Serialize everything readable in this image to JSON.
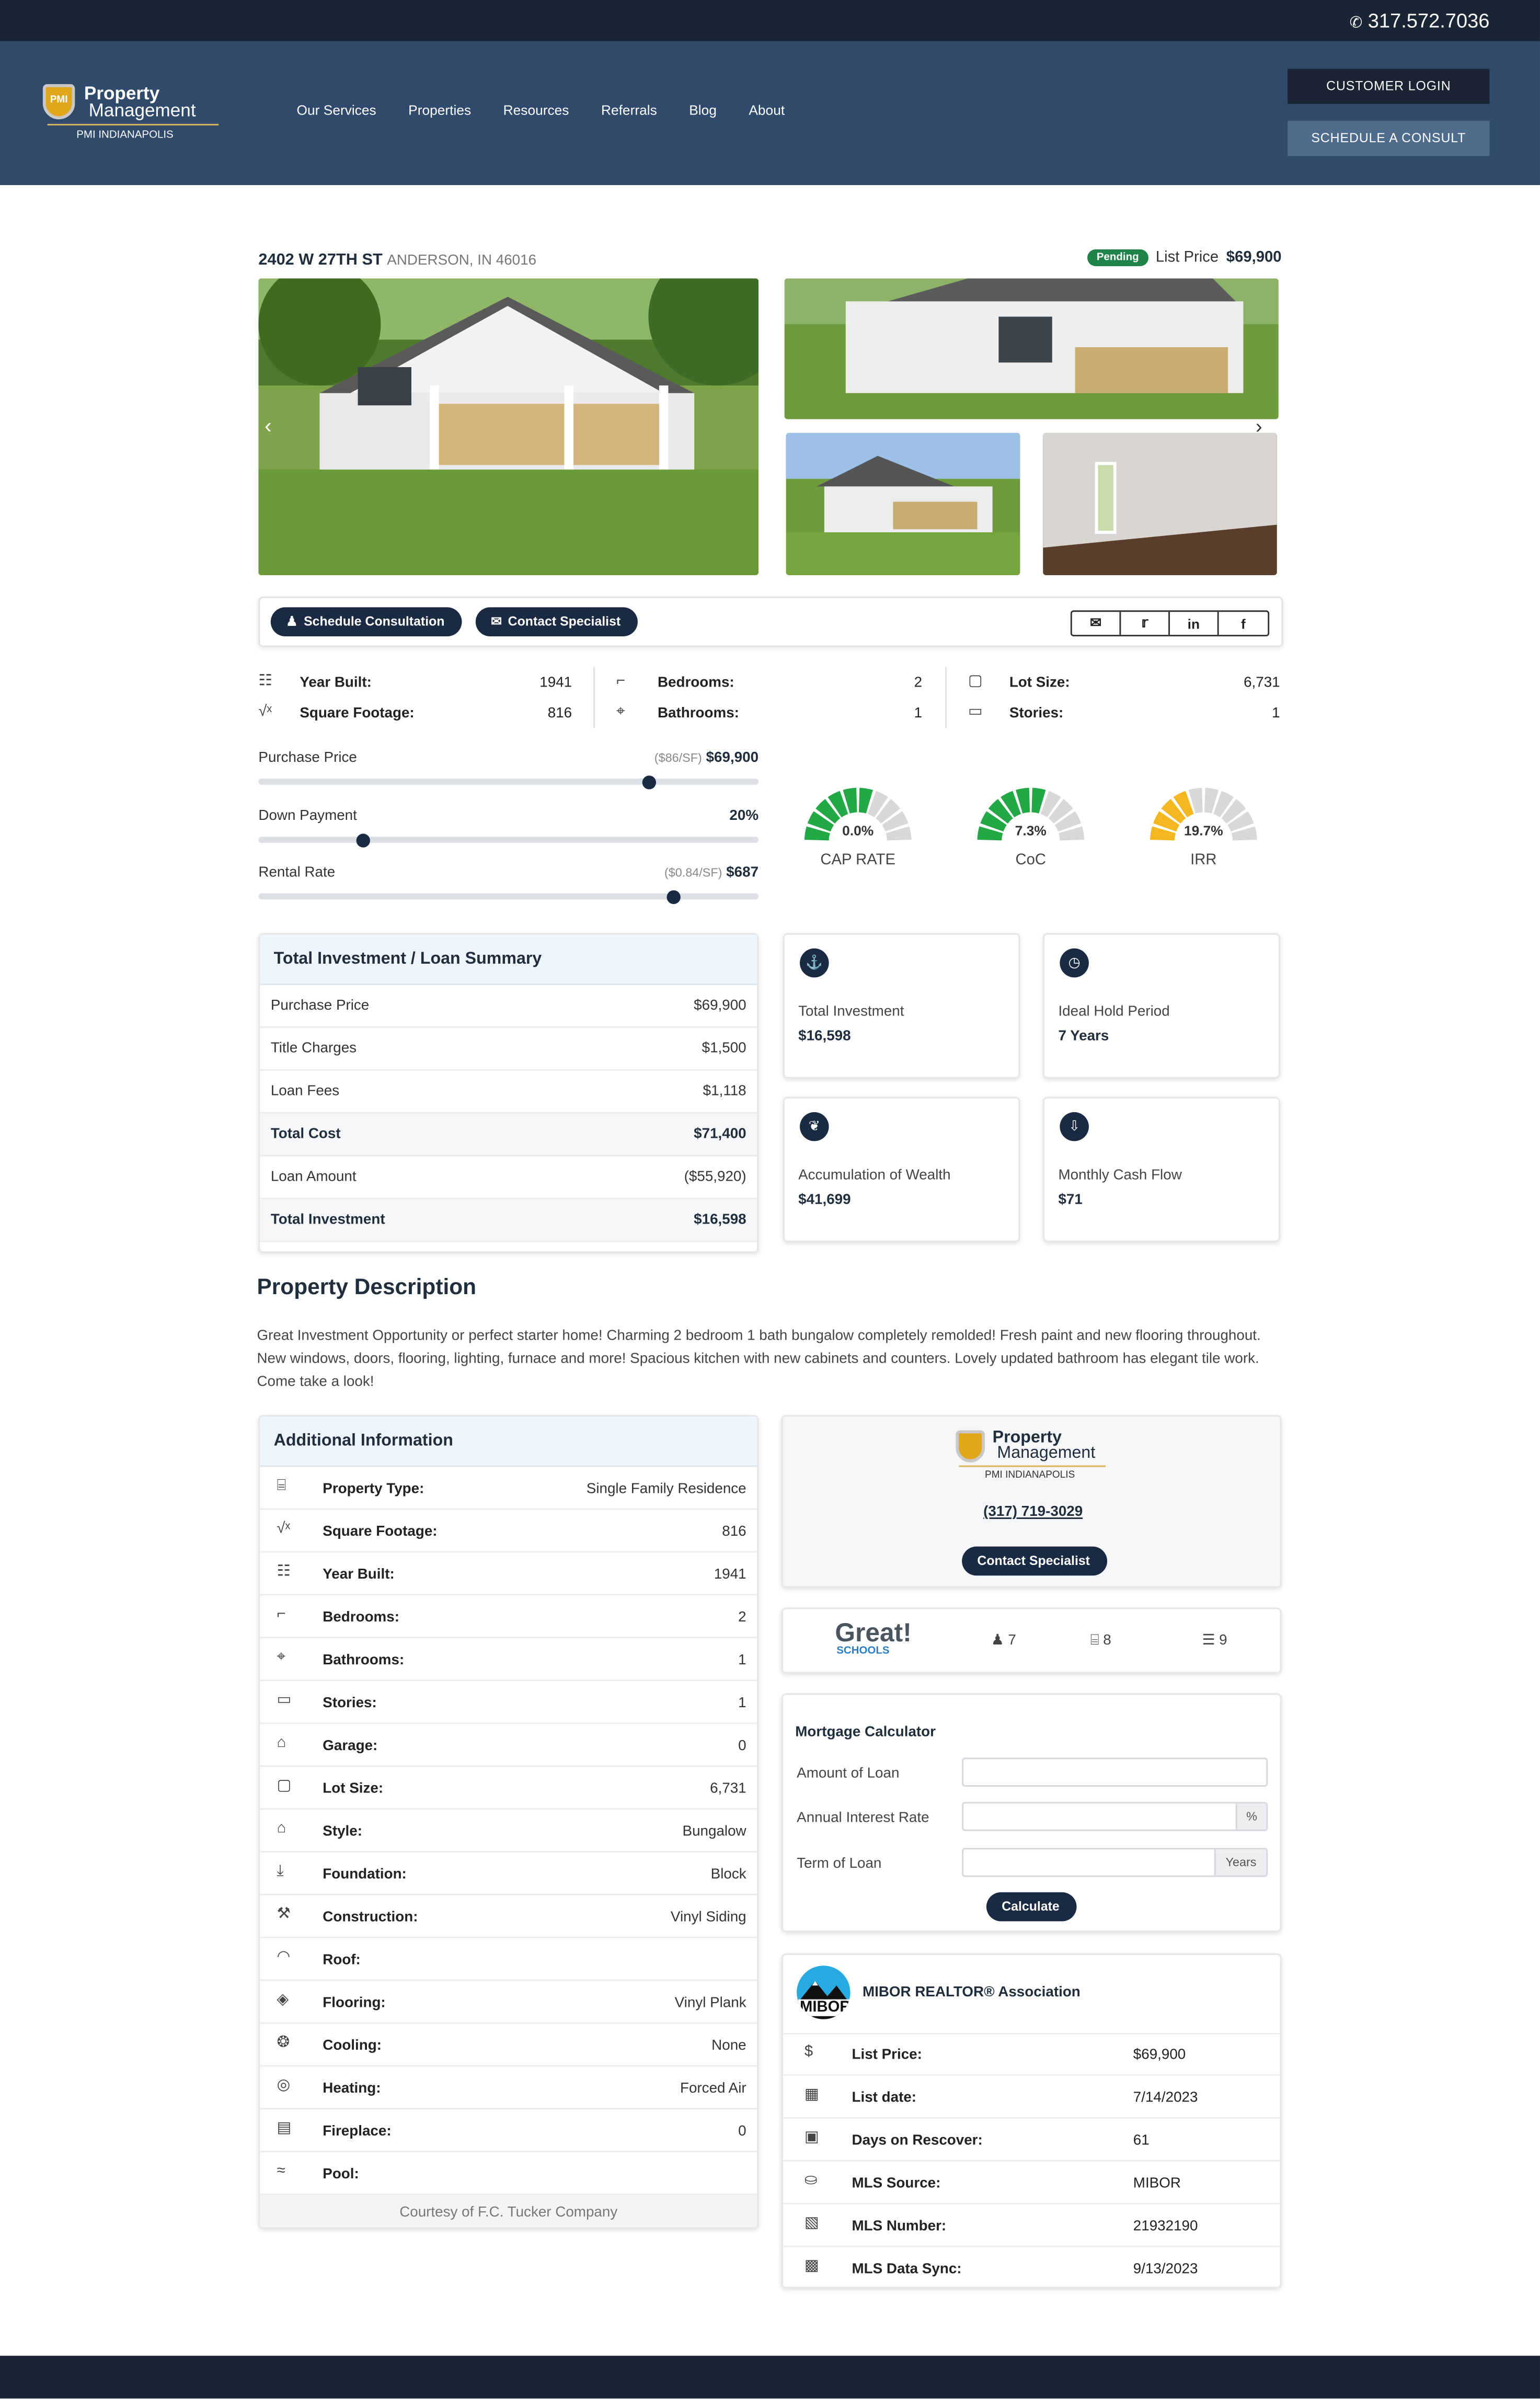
{
  "topbar": {
    "phone": "317.572.7036"
  },
  "header": {
    "logo": {
      "brand_line1": "Property",
      "brand_line2": "Management",
      "badge": "PMI",
      "sub": "PMI INDIANAPOLIS"
    },
    "nav": [
      "Our Services",
      "Properties",
      "Resources",
      "Referrals",
      "Blog",
      "About"
    ],
    "customer_login": "CUSTOMER LOGIN",
    "schedule_consult": "SCHEDULE A CONSULT"
  },
  "listing": {
    "street": "2402 W 27TH ST",
    "city": "ANDERSON, IN 46016",
    "status": "Pending",
    "list_price_label": "List Price",
    "list_price": "$69,900"
  },
  "actions": {
    "schedule": "Schedule Consultation",
    "contact": "Contact Specialist",
    "share_icons": [
      "mail-icon",
      "twitter-icon",
      "linkedin-icon",
      "facebook-icon"
    ]
  },
  "facts": [
    {
      "icon": "cake-icon",
      "label": "Year Built:",
      "value": "1941"
    },
    {
      "icon": "sqrt-icon",
      "label": "Square Footage:",
      "value": "816"
    },
    {
      "icon": "bed-icon",
      "label": "Bedrooms:",
      "value": "2"
    },
    {
      "icon": "bath-icon",
      "label": "Bathrooms:",
      "value": "1"
    },
    {
      "icon": "square-icon",
      "label": "Lot Size:",
      "value": "6,731"
    },
    {
      "icon": "stories-icon",
      "label": "Stories:",
      "value": "1"
    }
  ],
  "sliders": [
    {
      "label": "Purchase Price",
      "note": "($86/SF)",
      "value": "$69,900",
      "position": 0.78
    },
    {
      "label": "Down Payment",
      "note": "",
      "value": "20%",
      "position": 0.21
    },
    {
      "label": "Rental Rate",
      "note": "($0.84/SF)",
      "value": "$687",
      "position": 0.83
    }
  ],
  "gauges": [
    {
      "label": "CAP RATE",
      "value": "0.0%",
      "segments_filled": 6,
      "color": "#22a845"
    },
    {
      "label": "CoC",
      "value": "7.3%",
      "segments_filled": 6,
      "color": "#22a845"
    },
    {
      "label": "IRR",
      "value": "19.7%",
      "segments_filled": 4,
      "color": "#f4b71f"
    }
  ],
  "summary": {
    "title": "Total Investment / Loan Summary",
    "rows": [
      {
        "label": "Purchase Price",
        "value": "$69,900",
        "bold": false
      },
      {
        "label": "Title Charges",
        "value": "$1,500",
        "bold": false
      },
      {
        "label": "Loan Fees",
        "value": "$1,118",
        "bold": false
      },
      {
        "label": "Total Cost",
        "value": "$71,400",
        "bold": true
      },
      {
        "label": "Loan Amount",
        "value": "($55,920)",
        "bold": false
      },
      {
        "label": "Total Investment",
        "value": "$16,598",
        "bold": true
      }
    ]
  },
  "stats": [
    {
      "icon": "investment-icon",
      "label": "Total Investment",
      "value": "$16,598"
    },
    {
      "icon": "clock-icon",
      "label": "Ideal Hold Period",
      "value": "7 Years"
    },
    {
      "icon": "money-bag-icon",
      "label": "Accumulation of Wealth",
      "value": "$41,699"
    },
    {
      "icon": "cash-flow-icon",
      "label": "Monthly Cash Flow",
      "value": "$71"
    }
  ],
  "description": {
    "title": "Property Description",
    "text": "Great Investment Opportunity or perfect starter home! Charming 2 bedroom 1 bath bungalow completely remolded! Fresh paint and new flooring throughout. New windows, doors, flooring, lighting, furnace and more! Spacious kitchen with new cabinets and counters. Lovely updated bathroom has elegant tile work. Come take a look!"
  },
  "additional": {
    "title": "Additional Information",
    "rows": [
      {
        "icon": "building-icon",
        "label": "Property Type:",
        "value": "Single Family Residence"
      },
      {
        "icon": "sqrt-icon",
        "label": "Square Footage:",
        "value": "816"
      },
      {
        "icon": "cake-icon",
        "label": "Year Built:",
        "value": "1941"
      },
      {
        "icon": "bed-icon",
        "label": "Bedrooms:",
        "value": "2"
      },
      {
        "icon": "bath-icon",
        "label": "Bathrooms:",
        "value": "1"
      },
      {
        "icon": "stories-icon",
        "label": "Stories:",
        "value": "1"
      },
      {
        "icon": "garage-icon",
        "label": "Garage:",
        "value": "0"
      },
      {
        "icon": "square-icon",
        "label": "Lot Size:",
        "value": "6,731"
      },
      {
        "icon": "house-icon",
        "label": "Style:",
        "value": "Bungalow"
      },
      {
        "icon": "foundation-icon",
        "label": "Foundation:",
        "value": "Block"
      },
      {
        "icon": "tools-icon",
        "label": "Construction:",
        "value": "Vinyl Siding"
      },
      {
        "icon": "roof-icon",
        "label": "Roof:",
        "value": ""
      },
      {
        "icon": "layers-icon",
        "label": "Flooring:",
        "value": "Vinyl Plank"
      },
      {
        "icon": "fan-icon",
        "label": "Cooling:",
        "value": "None"
      },
      {
        "icon": "heating-icon",
        "label": "Heating:",
        "value": "Forced Air"
      },
      {
        "icon": "fireplace-icon",
        "label": "Fireplace:",
        "value": "0"
      },
      {
        "icon": "pool-icon",
        "label": "Pool:",
        "value": ""
      }
    ],
    "courtesy": "Courtesy of F.C. Tucker Company"
  },
  "agent": {
    "phone": "(317) 719-3029",
    "contact": "Contact Specialist"
  },
  "schools": {
    "brand1": "Great!",
    "brand2": "SCHOOLS",
    "items": [
      {
        "icon": "elementary-icon",
        "value": "7"
      },
      {
        "icon": "middle-school-icon",
        "value": "8"
      },
      {
        "icon": "high-school-icon",
        "value": "9"
      }
    ]
  },
  "mortgage": {
    "title": "Mortgage Calculator",
    "amount_label": "Amount of Loan",
    "rate_label": "Annual Interest Rate",
    "rate_suffix": "%",
    "term_label": "Term of Loan",
    "term_suffix": "Years",
    "button": "Calculate"
  },
  "mls": {
    "logo_text": "MIBOR",
    "title": "MIBOR REALTOR® Association",
    "rows": [
      {
        "icon": "dollar-icon",
        "label": "List Price:",
        "value": "$69,900"
      },
      {
        "icon": "calendar-icon",
        "label": "List date:",
        "value": "7/14/2023"
      },
      {
        "icon": "calendar-days-icon",
        "label": "Days on Rescover:",
        "value": "61"
      },
      {
        "icon": "database-icon",
        "label": "MLS Source:",
        "value": "MIBOR"
      },
      {
        "icon": "id-card-icon",
        "label": "MLS Number:",
        "value": "21932190"
      },
      {
        "icon": "sync-calendar-icon",
        "label": "MLS Data Sync:",
        "value": "9/13/2023"
      }
    ]
  }
}
